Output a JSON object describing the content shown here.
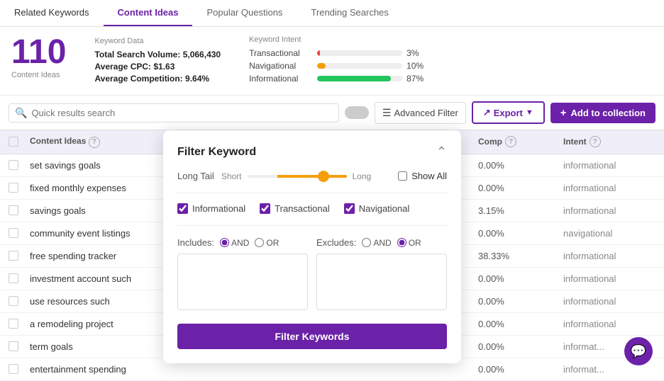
{
  "tabs": [
    {
      "id": "related-keywords",
      "label": "Related Keywords",
      "active": false
    },
    {
      "id": "content-ideas",
      "label": "Content Ideas",
      "active": true
    },
    {
      "id": "popular-questions",
      "label": "Popular Questions",
      "active": false
    },
    {
      "id": "trending-searches",
      "label": "Trending Searches",
      "active": false
    }
  ],
  "stats": {
    "big_number": "110",
    "big_label": "Content Ideas",
    "keyword_data_title": "Keyword Data",
    "total_search_volume_label": "Total Search Volume:",
    "total_search_volume": "5,066,430",
    "avg_cpc_label": "Average CPC:",
    "avg_cpc": "$1.63",
    "avg_comp_label": "Average Competition:",
    "avg_comp": "9.64%",
    "keyword_intent_title": "Keyword Intent",
    "intent_rows": [
      {
        "label": "Transactional",
        "pct": 3,
        "bar_color": "#ef4444",
        "pct_label": "3%"
      },
      {
        "label": "Navigational",
        "pct": 10,
        "bar_color": "#f59e0b",
        "pct_label": "10%"
      },
      {
        "label": "Informational",
        "pct": 87,
        "bar_color": "#22c55e",
        "pct_label": "87%"
      }
    ]
  },
  "toolbar": {
    "search_placeholder": "Quick results search",
    "adv_filter_label": "Advanced Filter",
    "export_label": "Export",
    "add_collection_label": "Add to collection"
  },
  "table": {
    "col_content_ideas": "Content Ideas",
    "col_comp": "Comp",
    "col_intent": "Intent",
    "rows": [
      {
        "keyword": "set savings goals",
        "comp": "0.00%",
        "intent": "informational"
      },
      {
        "keyword": "fixed monthly expenses",
        "comp": "0.00%",
        "intent": "informational"
      },
      {
        "keyword": "savings goals",
        "comp": "3.15%",
        "intent": "informational"
      },
      {
        "keyword": "community event listings",
        "comp": "0.00%",
        "intent": "navigational"
      },
      {
        "keyword": "free spending tracker",
        "comp": "38.33%",
        "intent": "informational"
      },
      {
        "keyword": "investment account such",
        "comp": "0.00%",
        "intent": "informational"
      },
      {
        "keyword": "use resources such",
        "comp": "0.00%",
        "intent": "informational"
      },
      {
        "keyword": "a remodeling project",
        "comp": "0.00%",
        "intent": "informational"
      },
      {
        "keyword": "term goals",
        "comp": "0.00%",
        "intent": "informat..."
      },
      {
        "keyword": "entertainment spending",
        "comp": "0.00%",
        "intent": "informat..."
      }
    ]
  },
  "filter_modal": {
    "title": "Filter Keyword",
    "longtail_label": "Long Tail",
    "slider_left": "Short",
    "slider_right": "Long",
    "show_all_label": "Show All",
    "intent_checks": [
      {
        "id": "informational",
        "label": "Informational",
        "checked": true
      },
      {
        "id": "transactional",
        "label": "Transactional",
        "checked": true
      },
      {
        "id": "navigational",
        "label": "Navigational",
        "checked": true
      }
    ],
    "includes_label": "Includes:",
    "includes_and": "AND",
    "includes_or": "OR",
    "excludes_label": "Excludes:",
    "excludes_and": "AND",
    "excludes_or": "OR",
    "filter_btn_label": "Filter Keywords"
  }
}
